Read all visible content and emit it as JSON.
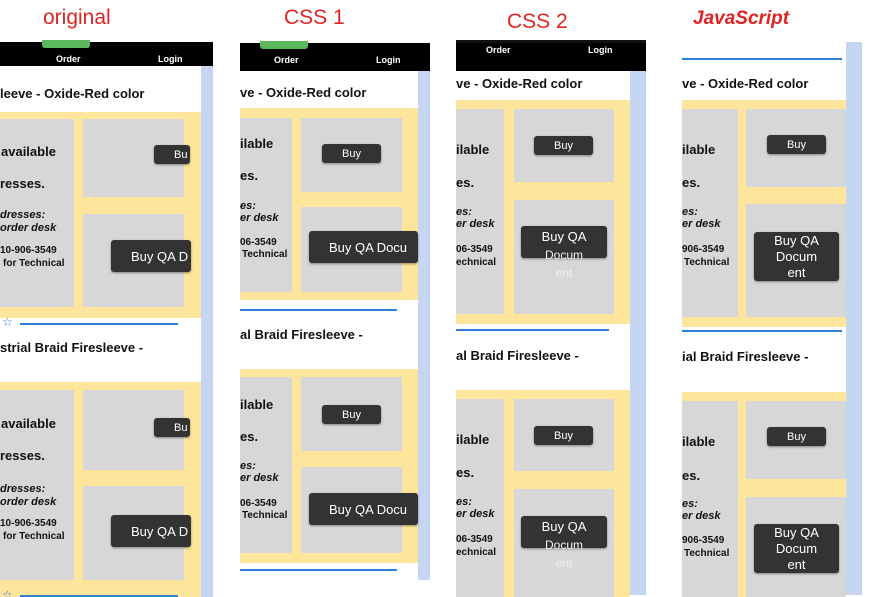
{
  "captions": {
    "original": "original",
    "css1": "CSS 1",
    "css2": "CSS 2",
    "javascript": "JavaScript"
  },
  "nav": {
    "order": "Order",
    "login": "Login"
  },
  "products": {
    "p1_full": "leeve - Oxide-Red color",
    "p1_short": "ve - Oxide-Red color",
    "p2_full": "strial Braid Firesleeve -",
    "p2_short": "al Braid Firesleeve -",
    "p2_js": "ial Braid Firesleeve -"
  },
  "availability": {
    "available_full": "available",
    "available_short": "ilable",
    "addresses_full": "resses.",
    "addresses_short": "es.",
    "addresses_label_full": "dresses:",
    "addresses_label_short": "es:",
    "order_desk_full": "order desk",
    "order_desk_short": "er desk",
    "phone_full": "10-906-3549",
    "phone_short": "06-3549",
    "phone_js": "906-3549",
    "technical_full": "for Technical",
    "technical_short": "Technical",
    "technical_mid": "echnical"
  },
  "buttons": {
    "buy": "Buy",
    "buy_clipped": "Bu",
    "buy_qa_clipped": "Buy QA D",
    "buy_qa_doc_clipped": "Buy QA Docu",
    "buy_qa_line1": "Buy QA",
    "buy_qa_line2": "Docum",
    "buy_qa_line3": "ent"
  },
  "colors": {
    "caption": "#e02424",
    "panel_bg": "#fde59b",
    "cell_bg": "#d7d7d7",
    "button_bg": "#333333",
    "accent_line": "#2f7fd6",
    "scrollbar": "#c6d6f2",
    "green": "#5cb85c"
  }
}
